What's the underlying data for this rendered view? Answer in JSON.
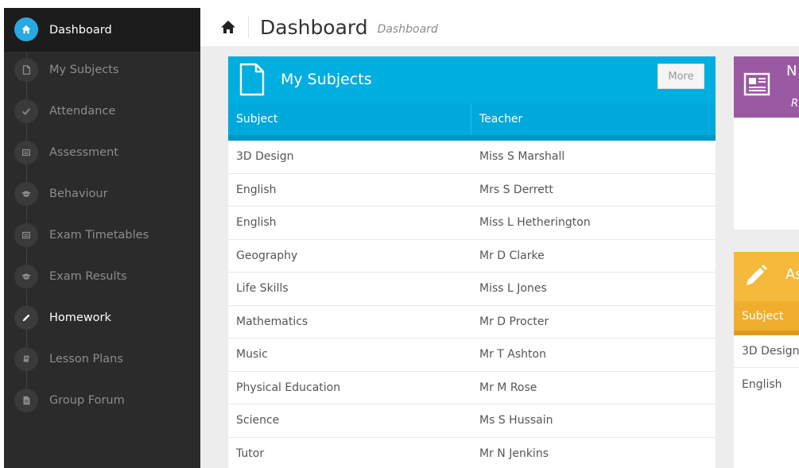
{
  "sidebar": {
    "items": [
      {
        "label": "Dashboard",
        "icon": "home-icon",
        "state": "active"
      },
      {
        "label": "My Subjects",
        "icon": "file-icon",
        "state": ""
      },
      {
        "label": "Attendance",
        "icon": "check-icon",
        "state": ""
      },
      {
        "label": "Assessment",
        "icon": "list-icon",
        "state": ""
      },
      {
        "label": "Behaviour",
        "icon": "graduation-cap-icon",
        "state": ""
      },
      {
        "label": "Exam Timetables",
        "icon": "list-icon",
        "state": ""
      },
      {
        "label": "Exam Results",
        "icon": "graduation-cap-icon",
        "state": ""
      },
      {
        "label": "Homework",
        "icon": "pencil-icon",
        "state": "current"
      },
      {
        "label": "Lesson Plans",
        "icon": "book-icon",
        "state": ""
      },
      {
        "label": "Group Forum",
        "icon": "document-icon",
        "state": ""
      }
    ]
  },
  "header": {
    "title": "Dashboard",
    "subtitle": "Dashboard"
  },
  "subjects_panel": {
    "title": "My Subjects",
    "more_label": "More",
    "columns": [
      "Subject",
      "Teacher"
    ],
    "rows": [
      [
        "3D Design",
        "Miss S Marshall"
      ],
      [
        "English",
        "Mrs S Derrett"
      ],
      [
        "English",
        "Miss L Hetherington"
      ],
      [
        "Geography",
        "Mr D Clarke"
      ],
      [
        "Life Skills",
        "Miss L Jones"
      ],
      [
        "Mathematics",
        "Mr D Procter"
      ],
      [
        "Music",
        "Mr T Ashton"
      ],
      [
        "Physical Education",
        "Mr M Rose"
      ],
      [
        "Science",
        "Ms S Hussain"
      ],
      [
        "Tutor",
        "Mr N Jenkins"
      ]
    ]
  },
  "news_panel": {
    "title_fragment": "N",
    "subtitle_fragment": "R"
  },
  "assessment_panel": {
    "title_fragment": "As",
    "column": "Subject",
    "rows": [
      "3D Design",
      "English"
    ]
  },
  "colors": {
    "sidebar_bg": "#2b2b2b",
    "accent_blue": "#00aee0",
    "purple": "#9b59a3",
    "yellow": "#f5b93b"
  }
}
